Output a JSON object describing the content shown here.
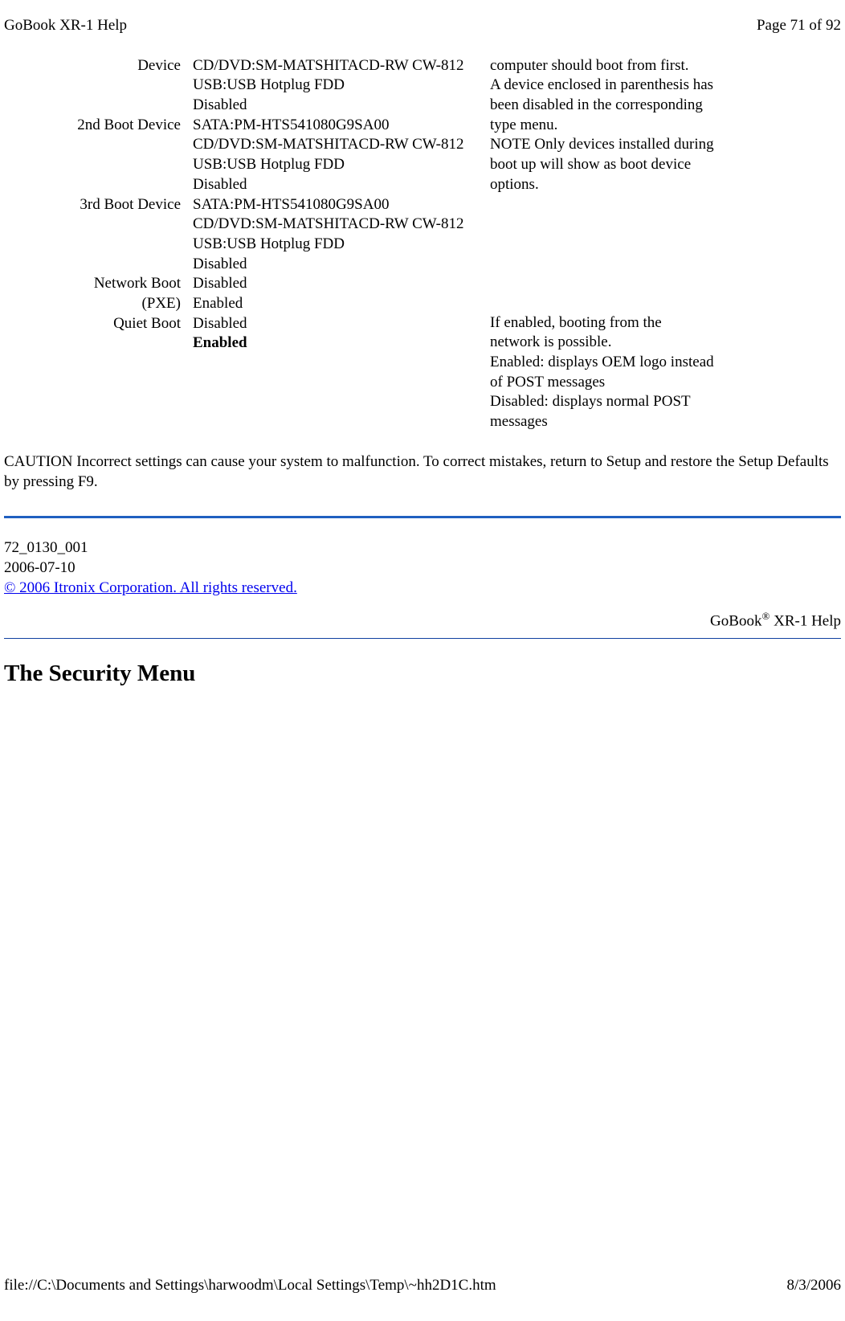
{
  "header": {
    "left": "GoBook XR-1 Help",
    "right": "Page 71 of 92"
  },
  "bootTable": {
    "rows": [
      {
        "label": "Device",
        "options": "CD/DVD:SM-MATSHITACD-RW CW-812\nUSB:USB Hotplug FDD\nDisabled"
      },
      {
        "label": "2nd Boot Device",
        "options": "SATA:PM-HTS541080G9SA00\nCD/DVD:SM-MATSHITACD-RW CW-812\nUSB:USB Hotplug FDD\nDisabled"
      },
      {
        "label": "3rd Boot Device",
        "options": "SATA:PM-HTS541080G9SA00\nCD/DVD:SM-MATSHITACD-RW CW-812\nUSB:USB Hotplug FDD\nDisabled"
      },
      {
        "label": "Network Boot (PXE)",
        "options": "Disabled\nEnabled"
      },
      {
        "label": "Quiet Boot",
        "options": "Disabled",
        "optionsBold": "Enabled"
      }
    ],
    "rightBlocks": [
      "computer should boot from first.\nA device enclosed in parenthesis has been disabled in the corresponding type menu.\nNOTE  Only devices installed during boot up will show as boot device options.",
      "If enabled, booting from the network is possible.",
      "Enabled: displays OEM logo instead of POST messages\nDisabled: displays normal POST messages"
    ]
  },
  "caution": "CAUTION  Incorrect settings can cause your system to malfunction. To correct mistakes, return to Setup and restore the Setup Defaults by pressing F9.",
  "docInfo": {
    "partNumber": "72_0130_001",
    "date": "2006-07-10",
    "copyright": "© 2006 Itronix Corporation. All rights reserved."
  },
  "brandLabel": {
    "prefix": "GoBook",
    "reg": "®",
    "suffix": " XR-1 Help"
  },
  "sectionHeader": "The Security Menu",
  "footer": {
    "left": "file://C:\\Documents and Settings\\harwoodm\\Local Settings\\Temp\\~hh2D1C.htm",
    "right": "8/3/2006"
  }
}
